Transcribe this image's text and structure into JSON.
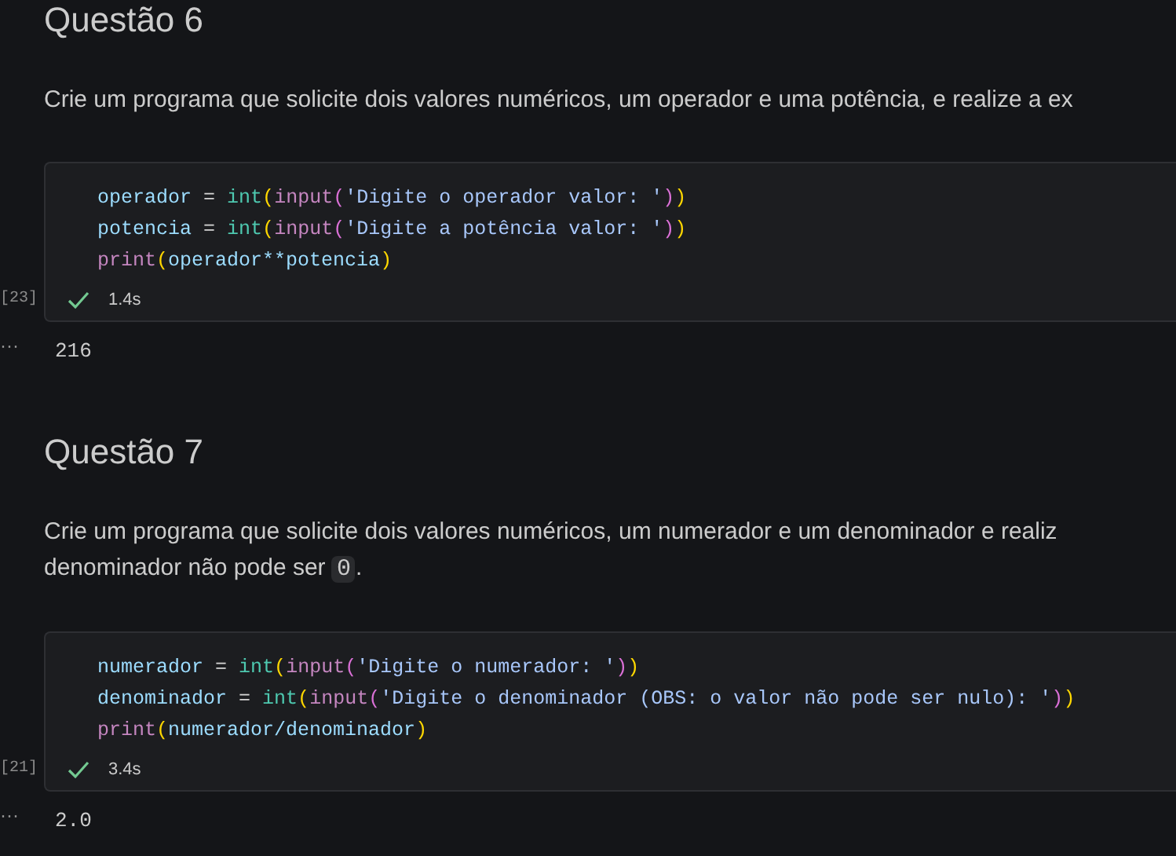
{
  "sections": [
    {
      "heading": "Questão 6",
      "paragraph": [
        {
          "kind": "text",
          "text": "Crie um programa que solicite dois valores numéricos, um operador e uma potência, e realize a ex"
        }
      ],
      "cell": {
        "execution_count": "[23]",
        "succeeded": true,
        "duration": "1.4s",
        "lines": [
          [
            {
              "kind": "var",
              "text": "operador"
            },
            {
              "kind": "op",
              "text": " = "
            },
            {
              "kind": "type",
              "text": "int"
            },
            {
              "kind": "paren1",
              "text": "("
            },
            {
              "kind": "func",
              "text": "input"
            },
            {
              "kind": "paren2",
              "text": "("
            },
            {
              "kind": "string",
              "text": "'Digite o operador valor: '"
            },
            {
              "kind": "paren2",
              "text": ")"
            },
            {
              "kind": "paren1",
              "text": ")"
            }
          ],
          [
            {
              "kind": "var",
              "text": "potencia"
            },
            {
              "kind": "op",
              "text": " = "
            },
            {
              "kind": "type",
              "text": "int"
            },
            {
              "kind": "paren1",
              "text": "("
            },
            {
              "kind": "func",
              "text": "input"
            },
            {
              "kind": "paren2",
              "text": "("
            },
            {
              "kind": "string",
              "text": "'Digite a potência valor: '"
            },
            {
              "kind": "paren2",
              "text": ")"
            },
            {
              "kind": "paren1",
              "text": ")"
            }
          ],
          [
            {
              "kind": "func",
              "text": "print"
            },
            {
              "kind": "paren1",
              "text": "("
            },
            {
              "kind": "var",
              "text": "operador**potencia"
            },
            {
              "kind": "paren1",
              "text": ")"
            }
          ]
        ]
      },
      "output_marker": "···",
      "output": "216"
    },
    {
      "heading": "Questão 7",
      "paragraph": [
        {
          "kind": "text",
          "text": "Crie um programa que solicite dois valores numéricos, um numerador e um denominador e realiz"
        },
        {
          "kind": "break"
        },
        {
          "kind": "text",
          "text": "denominador não pode ser "
        },
        {
          "kind": "code",
          "text": "0"
        },
        {
          "kind": "text",
          "text": "."
        }
      ],
      "cell": {
        "execution_count": "[21]",
        "succeeded": true,
        "duration": "3.4s",
        "lines": [
          [
            {
              "kind": "var",
              "text": "numerador"
            },
            {
              "kind": "op",
              "text": " = "
            },
            {
              "kind": "type",
              "text": "int"
            },
            {
              "kind": "paren1",
              "text": "("
            },
            {
              "kind": "func",
              "text": "input"
            },
            {
              "kind": "paren2",
              "text": "("
            },
            {
              "kind": "string",
              "text": "'Digite o numerador: '"
            },
            {
              "kind": "paren2",
              "text": ")"
            },
            {
              "kind": "paren1",
              "text": ")"
            }
          ],
          [
            {
              "kind": "var",
              "text": "denominador"
            },
            {
              "kind": "op",
              "text": " = "
            },
            {
              "kind": "type",
              "text": "int"
            },
            {
              "kind": "paren1",
              "text": "("
            },
            {
              "kind": "func",
              "text": "input"
            },
            {
              "kind": "paren2",
              "text": "("
            },
            {
              "kind": "string",
              "text": "'Digite o denominador (OBS: o valor não pode ser nulo): '"
            },
            {
              "kind": "paren2",
              "text": ")"
            },
            {
              "kind": "paren1",
              "text": ")"
            }
          ],
          [
            {
              "kind": "func",
              "text": "print"
            },
            {
              "kind": "paren1",
              "text": "("
            },
            {
              "kind": "var",
              "text": "numerador/denominador"
            },
            {
              "kind": "paren1",
              "text": ")"
            }
          ]
        ]
      },
      "output_marker": "···",
      "output": "2.0"
    }
  ]
}
